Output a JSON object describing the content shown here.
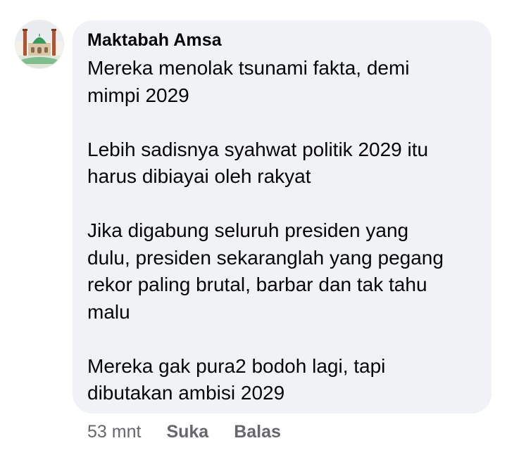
{
  "comment": {
    "author": "Maktabah Amsa",
    "paragraphs": [
      [
        "Mereka menolak tsunami fakta, demi",
        "mimpi 2029"
      ],
      [
        "Lebih sadisnya syahwat politik 2029 itu",
        "harus dibiayai oleh rakyat"
      ],
      [
        "Jika digabung seluruh presiden yang",
        "dulu, presiden sekaranglah yang pegang",
        "rekor paling brutal, barbar dan tak tahu",
        "malu"
      ],
      [
        "Mereka gak pura2 bodoh lagi, tapi",
        "dibutakan ambisi 2029"
      ]
    ],
    "time": "53 mnt",
    "like_label": "Suka",
    "reply_label": "Balas",
    "avatar_icon": "mosque-profile-picture"
  },
  "colors": {
    "bubble": "#f0f2f5",
    "text": "#050505",
    "meta": "#65676b"
  }
}
